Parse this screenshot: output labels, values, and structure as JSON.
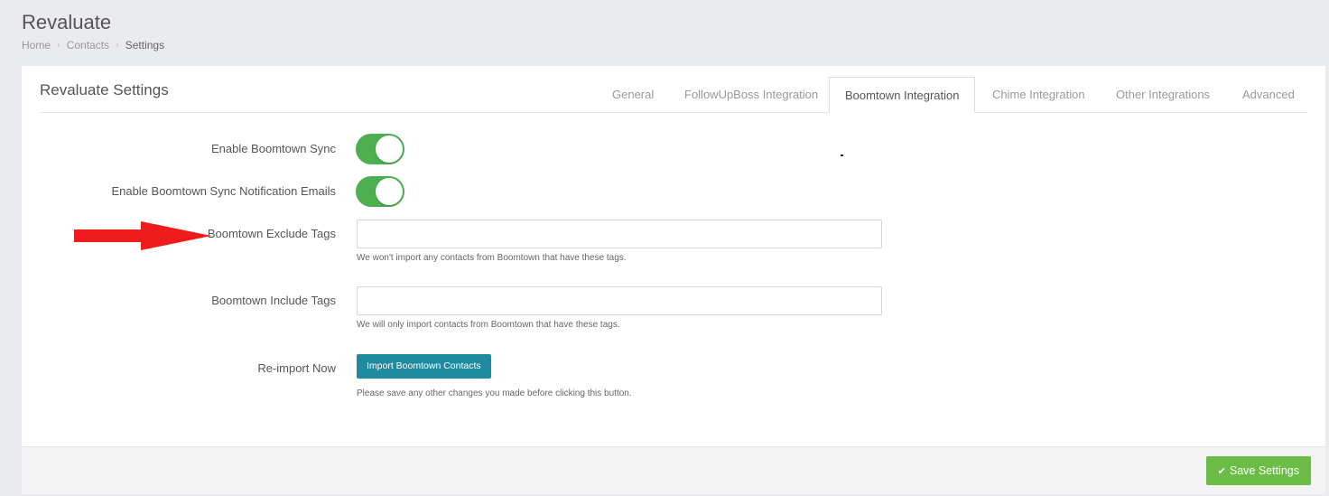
{
  "page": {
    "title": "Revaluate",
    "breadcrumb": [
      "Home",
      "Contacts",
      "Settings"
    ]
  },
  "panel": {
    "title": "Revaluate Settings",
    "tabs": [
      {
        "label": "General",
        "active": false
      },
      {
        "label": "FollowUpBoss Integration",
        "active": false
      },
      {
        "label": "Boomtown Integration",
        "active": true
      },
      {
        "label": "Chime Integration",
        "active": false
      },
      {
        "label": "Other Integrations",
        "active": false
      },
      {
        "label": "Advanced",
        "active": false
      }
    ]
  },
  "form": {
    "sync_label": "Enable Boomtown Sync",
    "sync_enabled": true,
    "notify_label": "Enable Boomtown Sync Notification Emails",
    "notify_enabled": true,
    "exclude_label": "Boomtown Exclude Tags",
    "exclude_value": "",
    "exclude_help": "We won't import any contacts from Boomtown that have these tags.",
    "include_label": "Boomtown Include Tags",
    "include_value": "",
    "include_help": "We will only import contacts from Boomtown that have these tags.",
    "reimport_label": "Re-import Now",
    "import_button": "Import Boomtown Contacts",
    "import_help": "Please save any other changes you made before clicking this button."
  },
  "footer": {
    "save_label": "Save Settings",
    "save_icon": "check-icon"
  },
  "colors": {
    "toggle_on": "#4caf50",
    "import_button": "#1f8ba0",
    "save_button": "#6cbd45",
    "annotation_arrow": "#ee1c1c"
  },
  "annotation": {
    "arrow_icon": "red-arrow-icon"
  }
}
